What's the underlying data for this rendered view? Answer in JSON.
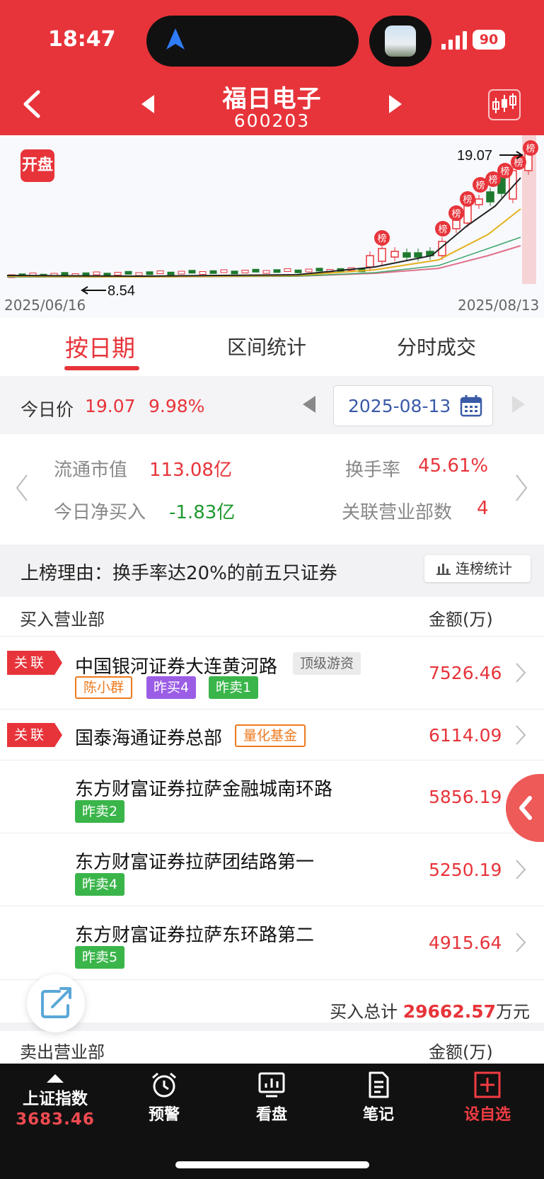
{
  "status": {
    "time": "18:47",
    "battery": "90"
  },
  "header": {
    "stock_name": "福日电子",
    "stock_code": "600203"
  },
  "chart": {
    "badge": "开盘",
    "start_date": "2025/06/16",
    "end_date": "2025/08/13",
    "high_label": "19.07",
    "low_label": "8.54",
    "bang_marker": "榜"
  },
  "tabs": {
    "by_date": "按日期",
    "interval": "区间统计",
    "timeshare": "分时成交"
  },
  "price_row": {
    "label": "今日价",
    "price": "19.07",
    "pct": "9.98%",
    "date": "2025-08-13"
  },
  "stats": {
    "float_cap_label": "流通市值",
    "float_cap": "113.08亿",
    "turnover_label": "换手率",
    "turnover": "45.61%",
    "net_buy_label": "今日净买入",
    "net_buy": "-1.83亿",
    "branch_count_label": "关联营业部数",
    "branch_count": "4"
  },
  "reason": {
    "text": "上榜理由：换手率达20%的前五只证券",
    "button": "连榜统计"
  },
  "buy": {
    "header_left": "买入营业部",
    "header_right": "金额(万)",
    "guanlian": "关联",
    "rows": [
      {
        "name": "中国银河证券大连黄河路",
        "type_tag": "顶级游资",
        "tags": [
          "陈小群",
          "昨买4",
          "昨卖1"
        ],
        "amount": "7526.46"
      },
      {
        "name": "国泰海通证券总部",
        "type_tag": "量化基金",
        "amount": "6114.09"
      },
      {
        "name": "东方财富证券拉萨金融城南环路",
        "tags": [
          "昨卖2"
        ],
        "amount": "5856.19"
      },
      {
        "name": "东方财富证券拉萨团结路第一",
        "tags": [
          "昨卖4"
        ],
        "amount": "5250.19"
      },
      {
        "name": "东方财富证券拉萨东环路第二",
        "tags": [
          "昨卖5"
        ],
        "amount": "4915.64"
      }
    ],
    "total_label": "买入总计",
    "total_value": "29662.57",
    "total_unit": "万元"
  },
  "sell": {
    "header_left": "卖出营业部",
    "header_right": "金额(万)"
  },
  "bottom_bar": {
    "index_name": "上证指数",
    "index_value": "3683.46",
    "alert": "预警",
    "watch": "看盘",
    "notes": "笔记",
    "add_watch": "设自选"
  },
  "colors": {
    "brand_red": "#e7343a",
    "green": "#1e9a2f",
    "purple_tag": "#9b5de5",
    "orange_tag": "#ee7a1e"
  }
}
